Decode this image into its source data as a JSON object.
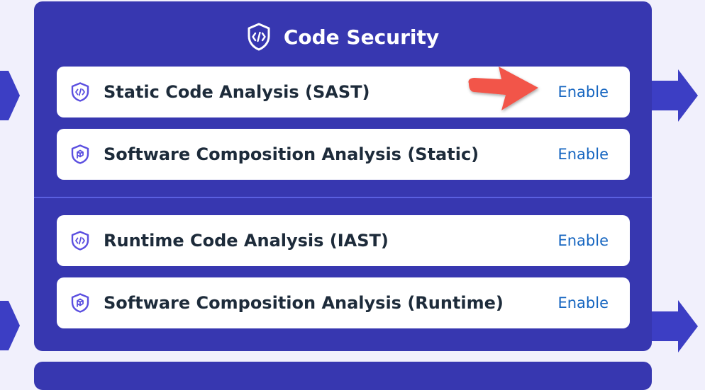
{
  "panel": {
    "title": "Code Security",
    "title_icon": "shield-code-icon",
    "colors": {
      "panel_bg": "#3737b0",
      "row_bg": "#ffffff",
      "link": "#1565c0",
      "arrow": "#f2554a"
    }
  },
  "rows": [
    {
      "label": "Static Code Analysis (SAST)",
      "action": "Enable",
      "icon": "shield-code-icon"
    },
    {
      "label": "Software Composition Analysis (Static)",
      "action": "Enable",
      "icon": "shield-package-icon"
    },
    {
      "label": "Runtime Code Analysis (IAST)",
      "action": "Enable",
      "icon": "shield-code-icon"
    },
    {
      "label": "Software Composition Analysis (Runtime)",
      "action": "Enable",
      "icon": "shield-package-icon"
    }
  ]
}
